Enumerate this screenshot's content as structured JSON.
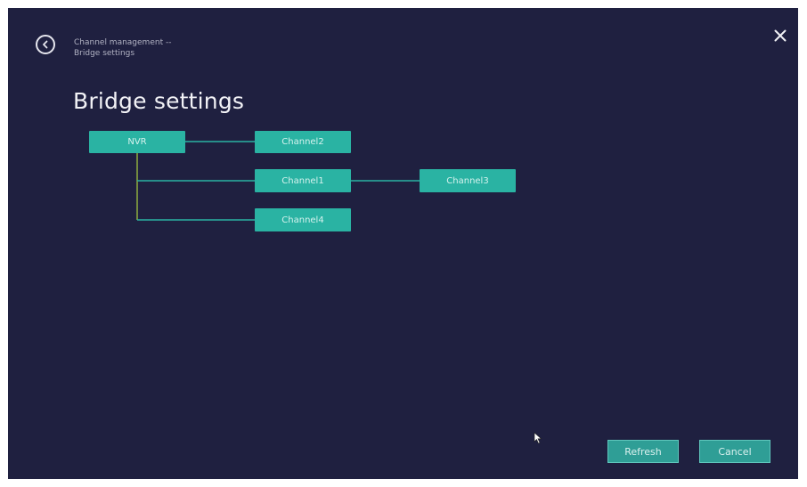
{
  "header": {
    "breadcrumb_line1": "Channel management --",
    "breadcrumb_line2": "Bridge settings"
  },
  "page": {
    "title": "Bridge settings"
  },
  "tree": {
    "root": "NVR",
    "nodes": [
      "Channel2",
      "Channel1",
      "Channel3",
      "Channel4"
    ]
  },
  "footer": {
    "refresh_label": "Refresh",
    "cancel_label": "Cancel"
  },
  "icons": {
    "back": "back-arrow-circle-icon",
    "close": "close-icon",
    "cursor": "mouse-pointer-icon"
  },
  "colors": {
    "background": "#1f2040",
    "node": "#2ab3a3",
    "connector_line": "#2ab3a3",
    "root_branch_line": "#8fae3f",
    "button": "#2f9e96",
    "text": "#f2f2f6"
  }
}
